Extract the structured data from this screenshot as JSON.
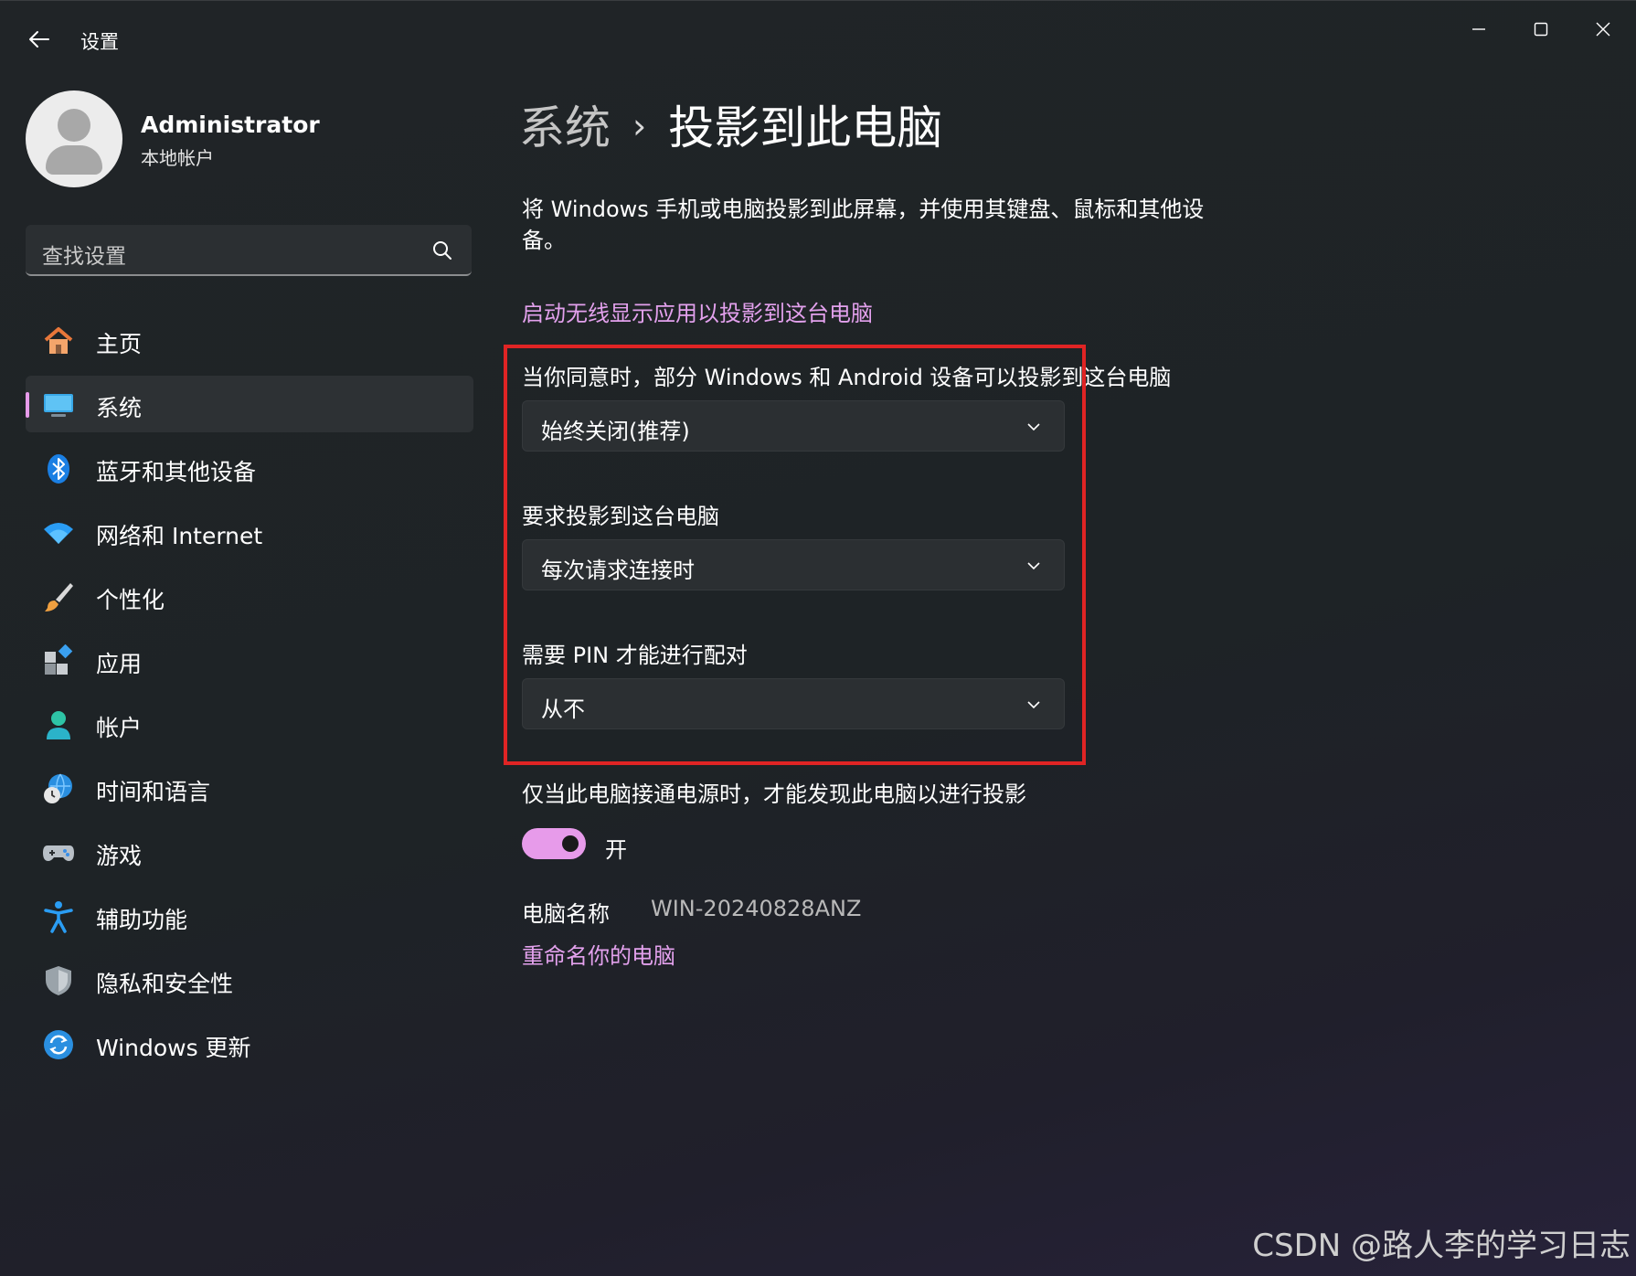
{
  "window": {
    "title": "设置"
  },
  "profile": {
    "name": "Administrator",
    "account_type": "本地帐户"
  },
  "search": {
    "placeholder": "查找设置"
  },
  "sidebar": {
    "items": [
      {
        "label": "主页",
        "icon": "home-icon"
      },
      {
        "label": "系统",
        "icon": "system-monitor-icon",
        "active": true
      },
      {
        "label": "蓝牙和其他设备",
        "icon": "bluetooth-icon"
      },
      {
        "label": "网络和 Internet",
        "icon": "wifi-icon"
      },
      {
        "label": "个性化",
        "icon": "brush-icon"
      },
      {
        "label": "应用",
        "icon": "apps-icon"
      },
      {
        "label": "帐户",
        "icon": "account-icon"
      },
      {
        "label": "时间和语言",
        "icon": "globe-clock-icon"
      },
      {
        "label": "游戏",
        "icon": "gamepad-icon"
      },
      {
        "label": "辅助功能",
        "icon": "accessibility-icon"
      },
      {
        "label": "隐私和安全性",
        "icon": "shield-icon"
      },
      {
        "label": "Windows 更新",
        "icon": "update-icon"
      }
    ]
  },
  "breadcrumb": {
    "parent": "系统",
    "separator": "›",
    "current": "投影到此电脑"
  },
  "main": {
    "description": "将 Windows 手机或电脑投影到此屏幕，并使用其键盘、鼠标和其他设备。",
    "launch_link": "启动无线显示应用以投影到这台电脑",
    "settings": [
      {
        "label": "当你同意时，部分 Windows 和 Android 设备可以投影到这台电脑",
        "value": "始终关闭(推荐)"
      },
      {
        "label": "要求投影到这台电脑",
        "value": "每次请求连接时"
      },
      {
        "label": "需要 PIN 才能进行配对",
        "value": "从不"
      }
    ],
    "power_setting": {
      "label": "仅当此电脑接通电源时，才能发现此电脑以进行投影",
      "toggle_state": "开",
      "on": true
    },
    "pc_name": {
      "label": "电脑名称",
      "value": "WIN-20240828ANZ"
    },
    "rename_link": "重命名你的电脑"
  },
  "colors": {
    "accent": "#e79bea",
    "highlight_box": "#e02424"
  },
  "watermark": "CSDN @路人李的学习日志"
}
